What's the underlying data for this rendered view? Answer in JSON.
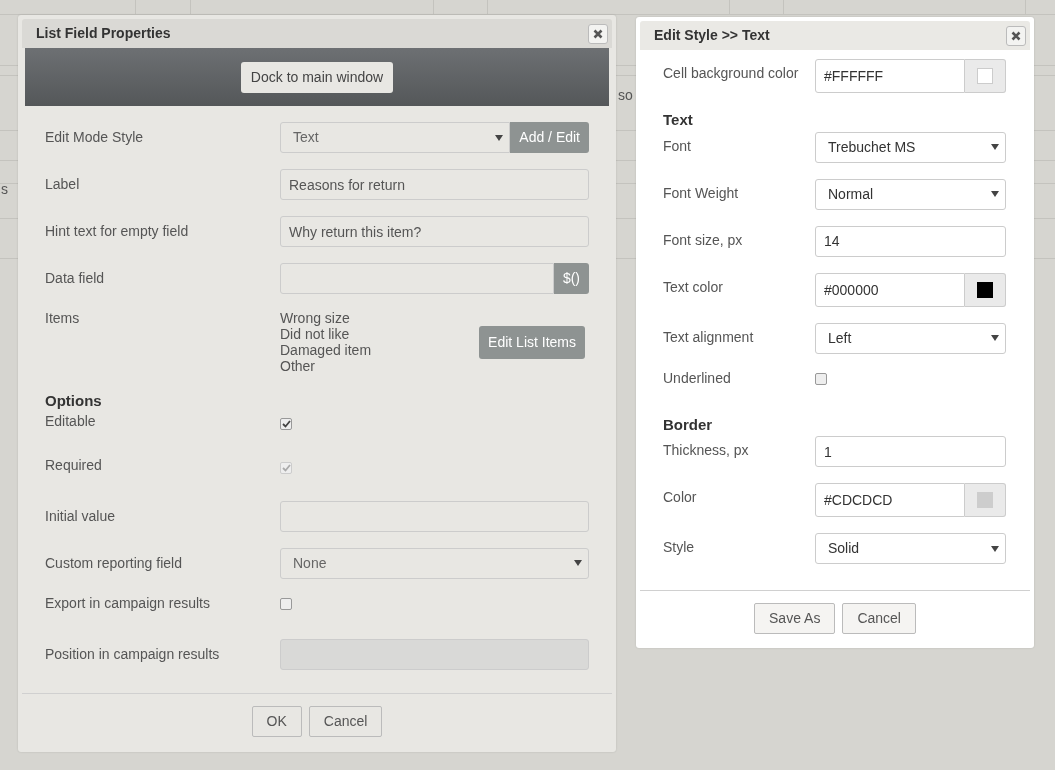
{
  "background": {
    "fragments": [
      "s",
      "so"
    ]
  },
  "list_dialog": {
    "title": "List Field Properties",
    "dock_button": "Dock to main window",
    "fields": [
      {
        "kind": "select_button",
        "label": "Edit Mode Style",
        "value": "Text",
        "button": "Add / Edit"
      },
      {
        "kind": "text",
        "label": "Label",
        "value": "Reasons for return"
      },
      {
        "kind": "text",
        "label": "Hint text for empty field",
        "value": "Why return this item?"
      },
      {
        "kind": "data",
        "label": "Data field",
        "button": "$()"
      },
      {
        "kind": "items",
        "label": "Items",
        "items": [
          "Wrong size",
          "Did not like",
          "Damaged item",
          "Other"
        ],
        "button": "Edit List Items"
      },
      {
        "kind": "heading",
        "label": "Options"
      },
      {
        "kind": "checkbox",
        "label": "Editable",
        "checked": true
      },
      {
        "kind": "checkbox",
        "label": "Required",
        "checked": true,
        "disabled": true
      },
      {
        "kind": "text",
        "label": "Initial value"
      },
      {
        "kind": "select",
        "label": "Custom reporting field",
        "value": "None"
      },
      {
        "kind": "checkbox",
        "label": "Export in campaign results",
        "checked": false
      },
      {
        "kind": "text",
        "label": "Position in campaign results",
        "disabled": true
      }
    ],
    "buttons": [
      "OK",
      "Cancel"
    ]
  },
  "style_dialog": {
    "title": "Edit Style >> Text",
    "fields": [
      {
        "kind": "color",
        "label": "Cell background color",
        "value": "#FFFFFF",
        "color": "#ffffff"
      },
      {
        "kind": "heading",
        "label": "Text"
      },
      {
        "kind": "select",
        "label": "Font",
        "value": "Trebuchet MS"
      },
      {
        "kind": "select",
        "label": "Font Weight",
        "value": "Normal"
      },
      {
        "kind": "text",
        "label": "Font size, px",
        "value": "14"
      },
      {
        "kind": "color",
        "label": "Text color",
        "value": "#000000",
        "color": "#000000"
      },
      {
        "kind": "select",
        "label": "Text alignment",
        "value": "Left"
      },
      {
        "kind": "checkbox",
        "label": "Underlined",
        "checked": false
      },
      {
        "kind": "heading",
        "label": "Border"
      },
      {
        "kind": "text",
        "label": "Thickness, px",
        "value": "1"
      },
      {
        "kind": "color",
        "label": "Color",
        "value": "#CDCDCD",
        "color": "#cdcdcd"
      },
      {
        "kind": "select",
        "label": "Style",
        "value": "Solid"
      }
    ],
    "buttons": [
      "Save As",
      "Cancel"
    ]
  }
}
